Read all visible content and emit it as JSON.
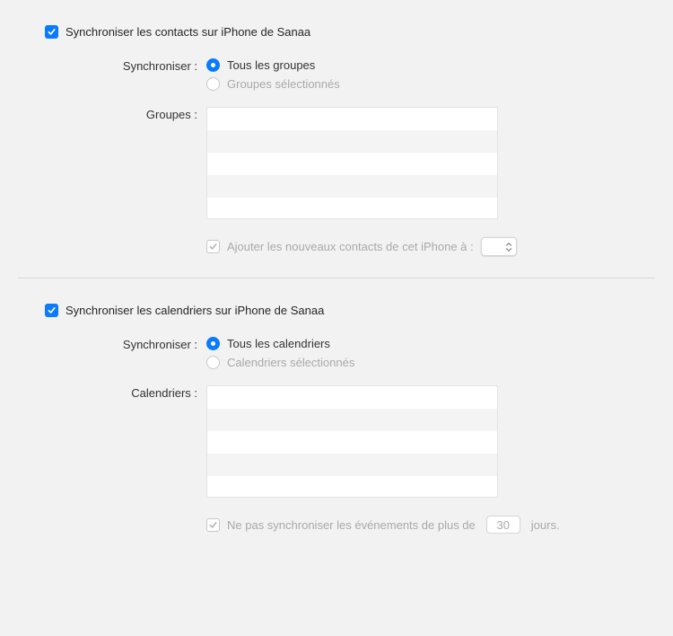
{
  "contacts": {
    "title": "Synchroniser les contacts sur iPhone de Sanaa",
    "checked": true,
    "sync_label": "Synchroniser :",
    "radio_all": "Tous les groupes",
    "radio_selected": "Groupes sélectionnés",
    "groups_label": "Groupes :",
    "add_new_label": "Ajouter les nouveaux contacts de cet iPhone à :"
  },
  "calendars": {
    "title": "Synchroniser les calendriers sur iPhone de Sanaa",
    "checked": true,
    "sync_label": "Synchroniser :",
    "radio_all": "Tous les calendriers",
    "radio_selected": "Calendriers sélectionnés",
    "calendars_label": "Calendriers :",
    "no_sync_label_pre": "Ne pas synchroniser les événements de plus de",
    "no_sync_days": "30",
    "no_sync_label_post": "jours."
  }
}
